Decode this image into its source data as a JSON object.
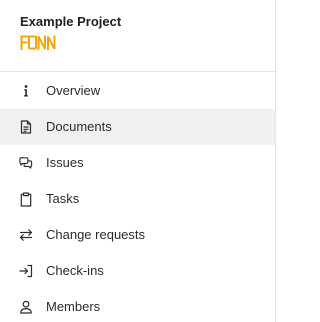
{
  "project": {
    "title": "Example Project",
    "logo_text": "FONN",
    "logo_color": "#f0a70a"
  },
  "nav": {
    "active_index": 1,
    "items": [
      {
        "label": "Overview",
        "icon": "info-icon"
      },
      {
        "label": "Documents",
        "icon": "document-icon"
      },
      {
        "label": "Issues",
        "icon": "chat-bubbles-icon"
      },
      {
        "label": "Tasks",
        "icon": "clipboard-icon"
      },
      {
        "label": "Change requests",
        "icon": "swap-arrows-icon"
      },
      {
        "label": "Check-ins",
        "icon": "sign-in-icon"
      },
      {
        "label": "Members",
        "icon": "user-icon"
      }
    ]
  },
  "colors": {
    "active_background": "#f0f0f2",
    "divider": "#e4e4e4",
    "text": "#2b2b2b"
  }
}
